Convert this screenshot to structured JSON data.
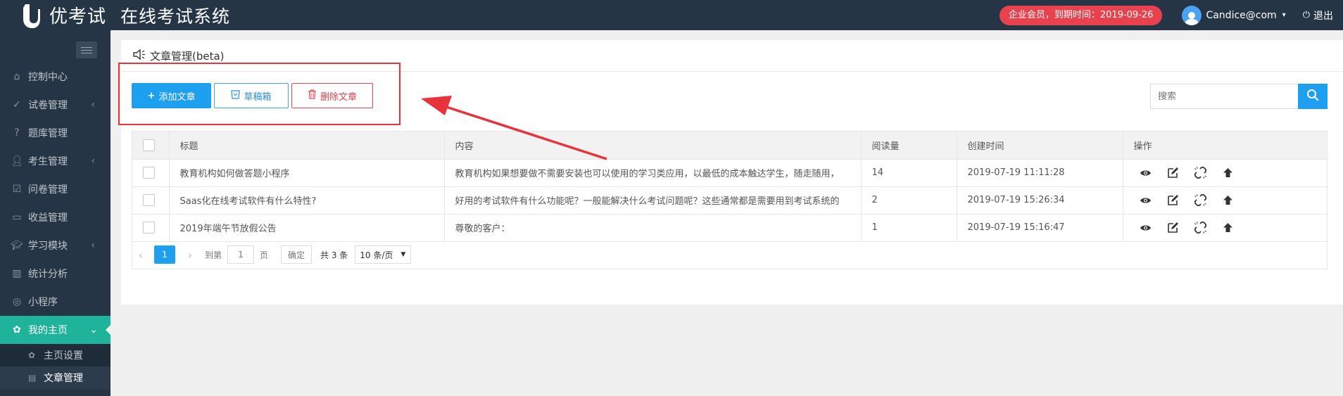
{
  "header": {
    "brand": "优考试",
    "system_title": "在线考试系统",
    "membership_badge": "企业会员，到期时间：2019-09-26",
    "username": "Candice@com",
    "logout_label": "退出"
  },
  "sidebar": {
    "items": [
      {
        "label": "控制中心",
        "icon": "home-icon"
      },
      {
        "label": "试卷管理",
        "icon": "check-circle-icon",
        "has_arrow": true
      },
      {
        "label": "题库管理",
        "icon": "question-circle-icon"
      },
      {
        "label": "考生管理",
        "icon": "user-icon",
        "has_arrow": true
      },
      {
        "label": "问卷管理",
        "icon": "checkbox-icon"
      },
      {
        "label": "收益管理",
        "icon": "card-icon"
      },
      {
        "label": "学习模块",
        "icon": "graduation-cap-icon",
        "has_arrow": true
      },
      {
        "label": "统计分析",
        "icon": "bar-chart-icon"
      },
      {
        "label": "小程序",
        "icon": "wechat-icon"
      },
      {
        "label": "我的主页",
        "icon": "leaf-icon",
        "active": true
      }
    ],
    "sub_items": [
      {
        "label": "主页设置",
        "icon": "leaf-icon"
      },
      {
        "label": "文章管理",
        "icon": "file-icon",
        "current": true
      }
    ]
  },
  "page": {
    "title": "文章管理(beta)",
    "add_button": "添加文章",
    "draft_button": "草稿箱",
    "delete_button": "删除文章",
    "search_placeholder": "搜索"
  },
  "table": {
    "columns": [
      "标题",
      "内容",
      "阅读量",
      "创建时间",
      "操作"
    ],
    "rows": [
      {
        "title": "教育机构如何做答题小程序",
        "content": "教育机构如果想要做不需要安装也可以使用的学习类应用，以最低的成本触达学生，随走随用，",
        "reads": "14",
        "created": "2019-07-19 11:11:28"
      },
      {
        "title": "Saas化在线考试软件有什么特性?",
        "content": "好用的考试软件有什么功能呢？一般能解决什么考试问题呢？这些通常都是需要用到考试系统的",
        "reads": "2",
        "created": "2019-07-19 15:26:34"
      },
      {
        "title": "2019年端午节放假公告",
        "content": "尊敬的客户：",
        "reads": "1",
        "created": "2019-07-19 15:16:47"
      }
    ]
  },
  "pager": {
    "current_page": "1",
    "goto_label": "到第",
    "page_input": "1",
    "page_unit": "页",
    "confirm_label": "确定",
    "total": "共 3 条",
    "page_size": "10 条/页"
  },
  "colors": {
    "header_bg": "#263545",
    "accent": "#1f9ff0",
    "active_menu": "#1fb39b",
    "danger": "#e8424f"
  }
}
